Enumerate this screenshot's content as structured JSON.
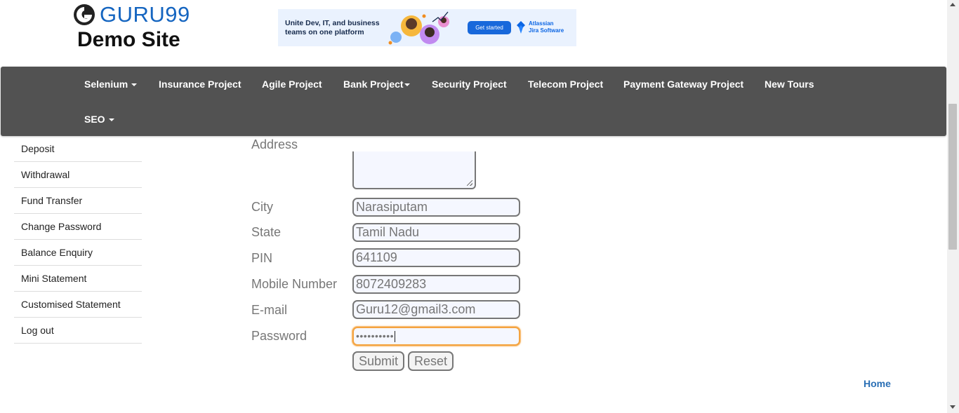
{
  "logo": {
    "brand": "GURU99",
    "subtitle": "Demo Site",
    "icon": "guru99-logo-icon",
    "brand_color": "#1565c0"
  },
  "ad": {
    "headline": "Unite Dev, IT, and business teams on one platform",
    "cta": "Get started",
    "brand_line1": "Atlassian",
    "brand_line2": "Jira Software",
    "cta_color": "#1868db"
  },
  "nav": {
    "items": [
      {
        "label": "Selenium",
        "dropdown": true
      },
      {
        "label": "Insurance Project",
        "dropdown": false
      },
      {
        "label": "Agile Project",
        "dropdown": false
      },
      {
        "label": "Bank Project",
        "dropdown": true
      },
      {
        "label": "Security Project",
        "dropdown": false
      },
      {
        "label": "Telecom Project",
        "dropdown": false
      },
      {
        "label": "Payment Gateway Project",
        "dropdown": false
      },
      {
        "label": "New Tours",
        "dropdown": false
      },
      {
        "label": "SEO",
        "dropdown": true
      }
    ],
    "background": "#525252"
  },
  "sidebar": {
    "clipped_item": "Deposit",
    "items": [
      {
        "label": "Withdrawal"
      },
      {
        "label": "Fund Transfer"
      },
      {
        "label": "Change Password"
      },
      {
        "label": "Balance Enquiry"
      },
      {
        "label": "Mini Statement"
      },
      {
        "label": "Customised Statement"
      },
      {
        "label": "Log out"
      }
    ]
  },
  "form": {
    "address_label": "Address",
    "fields": [
      {
        "label": "City",
        "value": "Narasiputam"
      },
      {
        "label": "State",
        "value": "Tamil Nadu"
      },
      {
        "label": "PIN",
        "value": "641109"
      },
      {
        "label": "Mobile Number",
        "value": "8072409283"
      },
      {
        "label": "E-mail",
        "value": "Guru12@gmail3.com"
      },
      {
        "label": "Password",
        "value": "••••••••••"
      }
    ],
    "submit_label": "Submit",
    "reset_label": "Reset",
    "focus_color": "#f4a340"
  },
  "footer": {
    "home_link": "Home",
    "link_color": "#2a6fb5"
  }
}
